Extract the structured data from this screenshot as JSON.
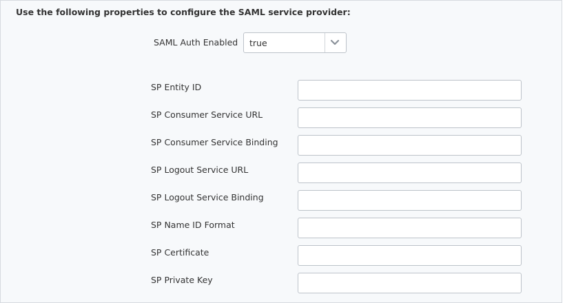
{
  "heading": "Use the following properties to configure the SAML service provider:",
  "saml_auth_enabled": {
    "label": "SAML Auth Enabled",
    "value": "true",
    "icon": "chevron-down-icon"
  },
  "fields": [
    {
      "label": "SP Entity ID",
      "value": ""
    },
    {
      "label": "SP Consumer Service URL",
      "value": ""
    },
    {
      "label": "SP Consumer Service Binding",
      "value": ""
    },
    {
      "label": "SP Logout Service URL",
      "value": ""
    },
    {
      "label": "SP Logout Service Binding",
      "value": ""
    },
    {
      "label": "SP Name ID Format",
      "value": ""
    },
    {
      "label": "SP Certificate",
      "value": ""
    },
    {
      "label": "SP Private Key",
      "value": ""
    }
  ],
  "colors": {
    "panel_bg": "#f7f9fb",
    "border": "#bcc2c9",
    "text": "#333333",
    "chevron": "#8a9199"
  }
}
